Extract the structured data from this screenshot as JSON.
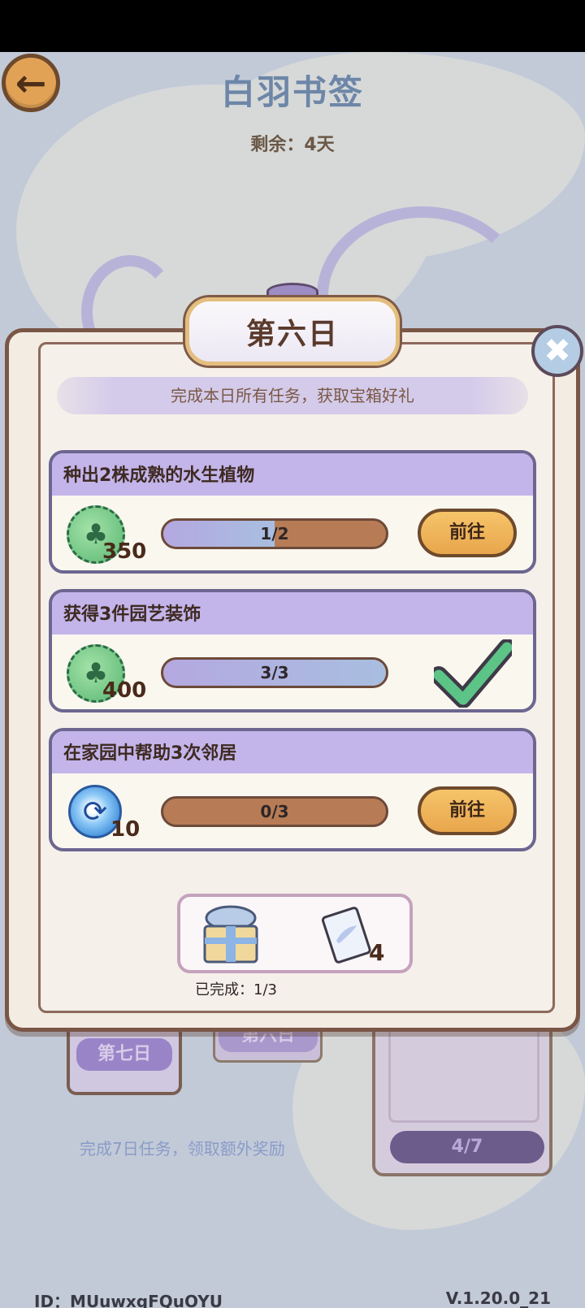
{
  "header": {
    "title": "白羽书签",
    "back_icon": "arrow-left-icon",
    "remaining": "剩余：4天"
  },
  "background": {
    "day_seven_tag": "第七日",
    "day_six_tag": "第六日",
    "week_hint": "完成7日任务，领取额外奖励",
    "week_progress": "4/7"
  },
  "dialog": {
    "title": "第六日",
    "subtitle": "完成本日所有任务，获取宝箱好礼",
    "close_icon": "close-icon",
    "tasks": [
      {
        "title": "种出2株成熟的水生植物",
        "reward_icon": "leaf-coin-icon",
        "reward_qty": "350",
        "progress_text": "1/2",
        "progress": 0.5,
        "action": "前往",
        "completed": false
      },
      {
        "title": "获得3件园艺装饰",
        "reward_icon": "leaf-coin-icon",
        "reward_qty": "400",
        "progress_text": "3/3",
        "progress": 1.0,
        "completed": true
      },
      {
        "title": "在家园中帮助3次邻居",
        "reward_icon": "spiral-coin-icon",
        "reward_qty": "10",
        "progress_text": "0/3",
        "progress": 0.0,
        "action": "前往",
        "completed": false
      }
    ],
    "chest": {
      "gift_icon": "gift-box-icon",
      "item_icon": "feather-scroll-icon",
      "item_qty": "4",
      "completed_label": "已完成：1/3"
    }
  },
  "footer": {
    "id_text": "ID：MUuwxgFQuOYU",
    "version": "V.1.20.0_21"
  },
  "colors": {
    "accent_orange": "#e8a64c",
    "task_header": "#c3b5ea",
    "progress_empty": "#b77c56",
    "check_green": "#5cc486"
  }
}
